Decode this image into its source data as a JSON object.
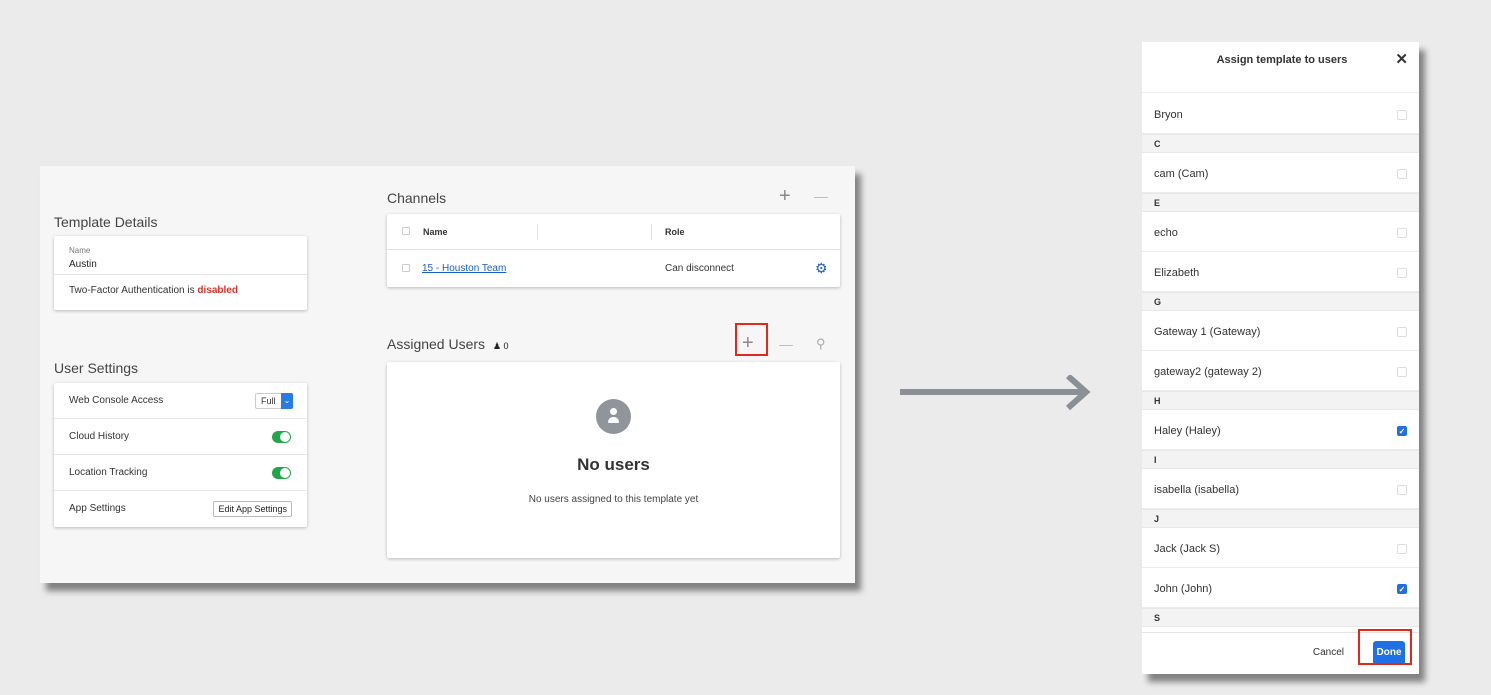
{
  "template": {
    "section_title": "Template Details",
    "name_label": "Name",
    "name_value": "Austin",
    "twofa_prefix": "Two-Factor Authentication is ",
    "twofa_status": "disabled"
  },
  "user_settings": {
    "section_title": "User Settings",
    "rows": [
      {
        "label": "Web Console Access",
        "control": "select",
        "value": "Full"
      },
      {
        "label": "Cloud History",
        "control": "toggle",
        "value": "on"
      },
      {
        "label": "Location Tracking",
        "control": "toggle",
        "value": "on"
      },
      {
        "label": "App Settings",
        "control": "button",
        "value": "Edit App Settings"
      }
    ]
  },
  "channels": {
    "section_title": "Channels",
    "add_icon": "+",
    "remove_icon": "—",
    "columns": {
      "name": "Name",
      "role": "Role"
    },
    "rows": [
      {
        "name": "15 - Houston Team",
        "role": "Can disconnect",
        "icon": "gear-icon"
      }
    ]
  },
  "assigned_users": {
    "section_title": "Assigned Users",
    "count": "0",
    "add_icon": "+",
    "remove_icon": "—",
    "search_icon": "⚲",
    "empty_title": "No users",
    "empty_desc": "No users assigned to this template yet"
  },
  "modal": {
    "title": "Assign template to users",
    "close_icon": "✕",
    "items": [
      {
        "type": "user",
        "name": "Bryon",
        "checked": false
      },
      {
        "type": "group",
        "name": "C"
      },
      {
        "type": "user",
        "name": "cam (Cam)",
        "checked": false
      },
      {
        "type": "group",
        "name": "E"
      },
      {
        "type": "user",
        "name": "echo",
        "checked": false
      },
      {
        "type": "user",
        "name": "Elizabeth",
        "checked": false
      },
      {
        "type": "group",
        "name": "G"
      },
      {
        "type": "user",
        "name": "Gateway 1 (Gateway)",
        "checked": false
      },
      {
        "type": "user",
        "name": "gateway2 (gateway 2)",
        "checked": false
      },
      {
        "type": "group",
        "name": "H"
      },
      {
        "type": "user",
        "name": "Haley (Haley)",
        "checked": true
      },
      {
        "type": "group",
        "name": "I"
      },
      {
        "type": "user",
        "name": "isabella (isabella)",
        "checked": false
      },
      {
        "type": "group",
        "name": "J"
      },
      {
        "type": "user",
        "name": "Jack (Jack S)",
        "checked": false
      },
      {
        "type": "user",
        "name": "John (John)",
        "checked": true
      },
      {
        "type": "group",
        "name": "S"
      }
    ],
    "cancel_label": "Cancel",
    "done_label": "Done"
  },
  "colors": {
    "accent": "#1f6fe5",
    "highlight": "#e0281b",
    "toggle_on": "#21a64b",
    "disabled_text": "#d9342b"
  }
}
